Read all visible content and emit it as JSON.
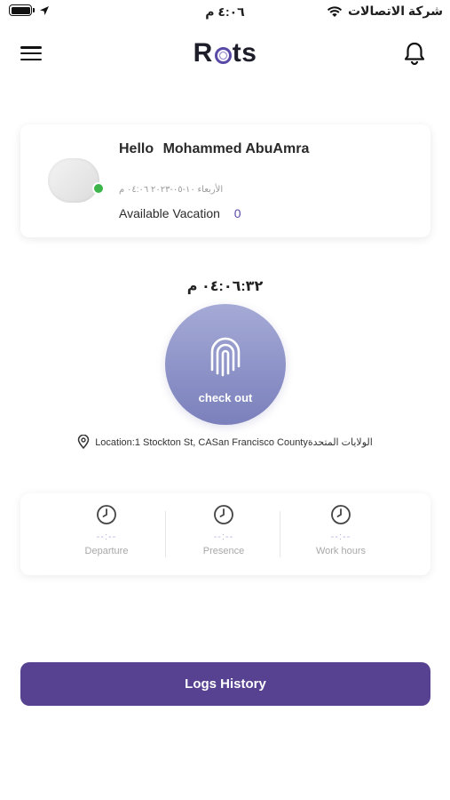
{
  "status_bar": {
    "time": "٤:٠٦ م",
    "carrier": "شركة الاتصالات"
  },
  "header": {
    "logo_prefix": "R",
    "logo_suffix": "ts",
    "menu_icon": "hamburger-menu-icon",
    "notification_icon": "bell-icon"
  },
  "profile": {
    "greeting": "Hello",
    "name": "Mohammed AbuAmra",
    "date_line": "الأربعاء ١٠-٠٥-٢٠٢٣ ٠٤:٠٦ م",
    "vacation_label": "Available Vacation",
    "vacation_count": "0",
    "online_color": "#3bb54a"
  },
  "attendance": {
    "current_time": "٠٤:٠٦:٣٢ م",
    "action_label": "check out",
    "location_text": "Location:1 Stockton St, CASan Francisco Countyالولايات المتحدة"
  },
  "stats": [
    {
      "value": "--:--",
      "label": "Departure",
      "icon": "clock-icon"
    },
    {
      "value": "--:--",
      "label": "Presence",
      "icon": "clock-icon"
    },
    {
      "value": "--:--",
      "label": "Work hours",
      "icon": "clock-icon"
    }
  ],
  "logs_button": {
    "label": "Logs History",
    "color": "#574291"
  }
}
